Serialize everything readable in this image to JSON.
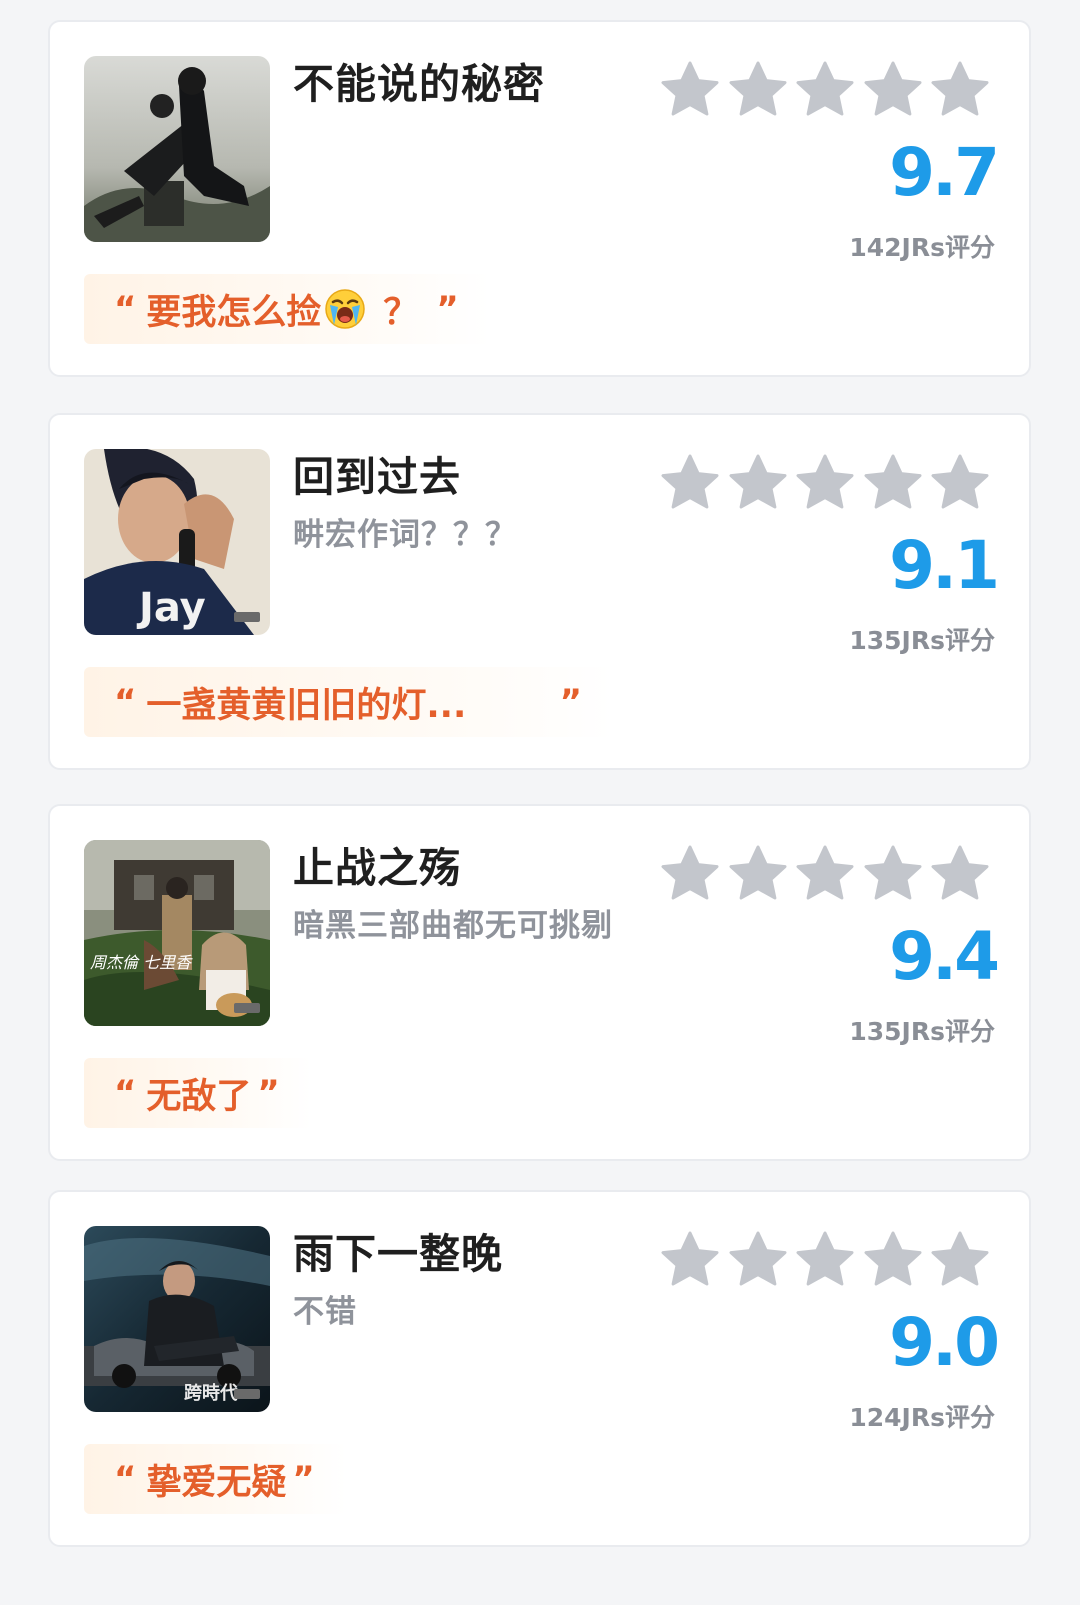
{
  "colors": {
    "title": "#1f1f1f",
    "subtitle": "#8f939b",
    "score": "#1e9be8",
    "star": "#c3c6cc",
    "quote_text": "#e45f2b",
    "quote_bg": "#fff3e6",
    "card_bg": "#ffffff",
    "page_bg": "#f4f5f7"
  },
  "cards": [
    {
      "title": "不能说的秘密",
      "subtitle": "",
      "stars_filled": 0,
      "stars_total": 5,
      "score": "9.7",
      "ratings": "142JRs评分",
      "quote": "要我怎么捡",
      "quote_emoji": "crying-face-icon",
      "quote_suffix": "？",
      "quote_open": "“",
      "quote_close": "”",
      "cover_icon": "album-cover-secret-icon"
    },
    {
      "title": "回到过去",
      "subtitle": "畊宏作词？？？",
      "stars_filled": 0,
      "stars_total": 5,
      "score": "9.1",
      "ratings": "135JRs评分",
      "quote": "一盏黄黄旧旧的灯...",
      "quote_open": "“",
      "quote_close": "”",
      "cover_icon": "album-cover-jay-icon",
      "cover_text": "Jay"
    },
    {
      "title": "止战之殇",
      "subtitle": "暗黑三部曲都无可挑剔",
      "stars_filled": 0,
      "stars_total": 5,
      "score": "9.4",
      "ratings": "135JRs评分",
      "quote": "无敌了",
      "quote_open": "“",
      "quote_close": "”",
      "cover_icon": "album-cover-qilixiang-icon"
    },
    {
      "title": "雨下一整晚",
      "subtitle": "不错",
      "stars_filled": 0,
      "stars_total": 5,
      "score": "9.0",
      "ratings": "124JRs评分",
      "quote": "挚爱无疑",
      "quote_open": "“",
      "quote_close": "”",
      "cover_icon": "album-cover-kuashidai-icon"
    }
  ]
}
